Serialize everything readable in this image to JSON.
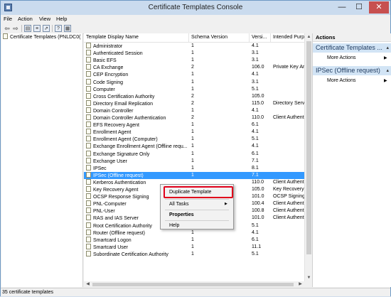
{
  "window": {
    "title": "Certificate Templates Console",
    "minimize": "—",
    "maximize": "☐",
    "close": "✕"
  },
  "menu": [
    "File",
    "Action",
    "View",
    "Help"
  ],
  "toolbar": [
    "back-arrow-icon",
    "forward-arrow-icon",
    "console-tree-icon",
    "list-view-icon",
    "export-list-icon",
    "help-icon",
    "properties-icon"
  ],
  "tree": {
    "root_label": "Certificate Templates (PNLDC0("
  },
  "list": {
    "columns": [
      "Template Display Name",
      "Schema Version",
      "Versi...",
      "Intended Purpo..."
    ],
    "rows": [
      [
        "Administrator",
        "1",
        "4.1",
        ""
      ],
      [
        "Authenticated Session",
        "1",
        "3.1",
        ""
      ],
      [
        "Basic EFS",
        "1",
        "3.1",
        ""
      ],
      [
        "CA Exchange",
        "2",
        "106.0",
        "Private Key Arc"
      ],
      [
        "CEP Encryption",
        "1",
        "4.1",
        ""
      ],
      [
        "Code Signing",
        "1",
        "3.1",
        ""
      ],
      [
        "Computer",
        "1",
        "5.1",
        ""
      ],
      [
        "Cross Certification Authority",
        "2",
        "105.0",
        ""
      ],
      [
        "Directory Email Replication",
        "2",
        "115.0",
        "Directory Servi"
      ],
      [
        "Domain Controller",
        "1",
        "4.1",
        ""
      ],
      [
        "Domain Controller Authentication",
        "2",
        "110.0",
        "Client Authent"
      ],
      [
        "EFS Recovery Agent",
        "1",
        "6.1",
        ""
      ],
      [
        "Enrollment Agent",
        "1",
        "4.1",
        ""
      ],
      [
        "Enrollment Agent (Computer)",
        "1",
        "5.1",
        ""
      ],
      [
        "Exchange Enrollment Agent (Offline requ...",
        "1",
        "4.1",
        ""
      ],
      [
        "Exchange Signature Only",
        "1",
        "6.1",
        ""
      ],
      [
        "Exchange User",
        "1",
        "7.1",
        ""
      ],
      [
        "IPSec",
        "1",
        "8.1",
        ""
      ],
      [
        "IPSec (Offline request)",
        "1",
        "7.1",
        ""
      ],
      [
        "Kerberos Authentication",
        "",
        "110.0",
        "Client Authent"
      ],
      [
        "Key Recovery Agent",
        "",
        "105.0",
        "Key Recovery A"
      ],
      [
        "OCSP Response Signing",
        "",
        "101.0",
        "OCSP Signing"
      ],
      [
        "PNL-Computer",
        "",
        "100.4",
        "Client Authent"
      ],
      [
        "PNL-User",
        "",
        "100.8",
        "Client Authent"
      ],
      [
        "RAS and IAS Server",
        "",
        "101.0",
        "Client Authent"
      ],
      [
        "Root Certification Authority",
        "1",
        "5.1",
        ""
      ],
      [
        "Router (Offline request)",
        "1",
        "4.1",
        ""
      ],
      [
        "Smartcard Logon",
        "1",
        "6.1",
        ""
      ],
      [
        "Smartcard User",
        "1",
        "11.1",
        ""
      ],
      [
        "Subordinate Certification Authority",
        "1",
        "5.1",
        ""
      ]
    ],
    "selected_index": 18
  },
  "actions": {
    "title": "Actions",
    "sections": [
      {
        "label": "Certificate Templates ...",
        "items": [
          "More Actions"
        ]
      },
      {
        "label": "IPSec (Offline request)",
        "items": [
          "More Actions"
        ]
      }
    ]
  },
  "context_menu": {
    "items": [
      "Duplicate Template",
      "All Tasks",
      "Properties",
      "Help"
    ],
    "submenu_arrow": "▶"
  },
  "status": "35 certificate templates",
  "colors": {
    "selection": "#3399ff",
    "highlight_box": "#e0001b",
    "action_header": "#d2e4f5"
  }
}
